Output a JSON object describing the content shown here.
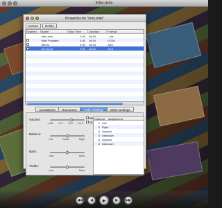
{
  "player": {
    "title": "Intro.m4v",
    "controls": {
      "rewind": "◀◀",
      "back": "◀",
      "play": "▶",
      "forward": "▶",
      "fast_forward": "▶▶"
    }
  },
  "window": {
    "title": "Properties for \"Intro.m4v\""
  },
  "toolbar": {
    "extract_label": "Extract",
    "delete_label": "Delete"
  },
  "table": {
    "headers": {
      "enabled": "Enabled",
      "name": "Name",
      "start": "Start Time",
      "duration": "Duration",
      "format": "Format"
    },
    "rows": [
      {
        "enabled": false,
        "name": "Intro.m4v",
        "start": "0.00",
        "duration": "18.54",
        "format": "- n/a -"
      },
      {
        "enabled": true,
        "name": "Main Program",
        "start": "0.00",
        "duration": "18.54",
        "format": "H.264"
      },
      {
        "enabled": true,
        "name": "Stereo",
        "start": "0.00",
        "duration": "18.54",
        "format": "AAC"
      },
      {
        "enabled": true,
        "name": "Surround",
        "start": "0.00",
        "duration": "18.54",
        "format": "AC3"
      }
    ]
  },
  "tabs": [
    {
      "label": "Annotations",
      "active": false
    },
    {
      "label": "Resources",
      "active": false
    },
    {
      "label": "Audio Settings",
      "active": true
    },
    {
      "label": "Other Settings",
      "active": false
    }
  ],
  "audio": {
    "volume_label": "Volume:",
    "volume_ticks": [
      "-∞dB",
      "+0.0",
      "+6.0",
      "+12.0"
    ],
    "mute_label": "Mute",
    "solo_label": "Solo",
    "balance_label": "Balance:",
    "balance_ticks": [
      "Left",
      "Center",
      "Right"
    ],
    "bass_label": "Bass:",
    "treble_label": "Treble:",
    "eq_ticks": [
      "Less",
      "More"
    ],
    "volume_level": 0.62,
    "balance_level": 0.5,
    "bass_level": 0.5,
    "treble_level": 0.5
  },
  "channels": {
    "headers": {
      "channel": "Channel",
      "assignment": "Assignment"
    },
    "rows": [
      {
        "n": "1",
        "a": "Left"
      },
      {
        "n": "2",
        "a": "Right"
      },
      {
        "n": "3",
        "a": "Unused"
      },
      {
        "n": "4",
        "a": "Unknown"
      },
      {
        "n": "5",
        "a": "Unused"
      },
      {
        "n": "6",
        "a": "Unknown"
      }
    ]
  },
  "colors": {
    "selection": "#3b73d9",
    "accent": "#3a76d8"
  }
}
